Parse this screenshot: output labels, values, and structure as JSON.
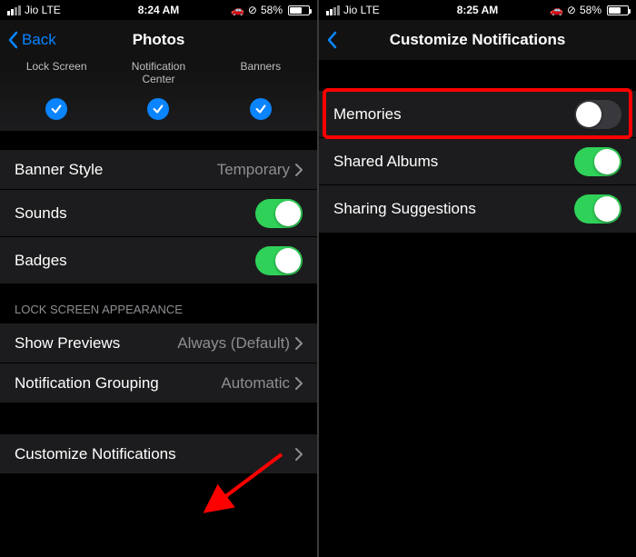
{
  "left": {
    "status": {
      "carrier": "Jio  LTE",
      "time": "8:24 AM",
      "battery_pct": "58%",
      "battery_fill": 58
    },
    "nav": {
      "back_label": "Back",
      "title": "Photos"
    },
    "alert_types": {
      "label1": "Lock Screen",
      "label2": "Notification\nCenter",
      "label3": "Banners"
    },
    "banner_style": {
      "label": "Banner Style",
      "value": "Temporary"
    },
    "sounds": {
      "label": "Sounds"
    },
    "badges": {
      "label": "Badges"
    },
    "section_lock": "LOCK SCREEN APPEARANCE",
    "previews": {
      "label": "Show Previews",
      "value": "Always (Default)"
    },
    "grouping": {
      "label": "Notification Grouping",
      "value": "Automatic"
    },
    "customize": {
      "label": "Customize Notifications"
    }
  },
  "right": {
    "status": {
      "carrier": "Jio  LTE",
      "time": "8:25 AM",
      "battery_pct": "58%",
      "battery_fill": 58
    },
    "nav": {
      "title": "Customize Notifications"
    },
    "memories": {
      "label": "Memories"
    },
    "shared_albums": {
      "label": "Shared Albums"
    },
    "sharing_suggestions": {
      "label": "Sharing Suggestions"
    }
  }
}
